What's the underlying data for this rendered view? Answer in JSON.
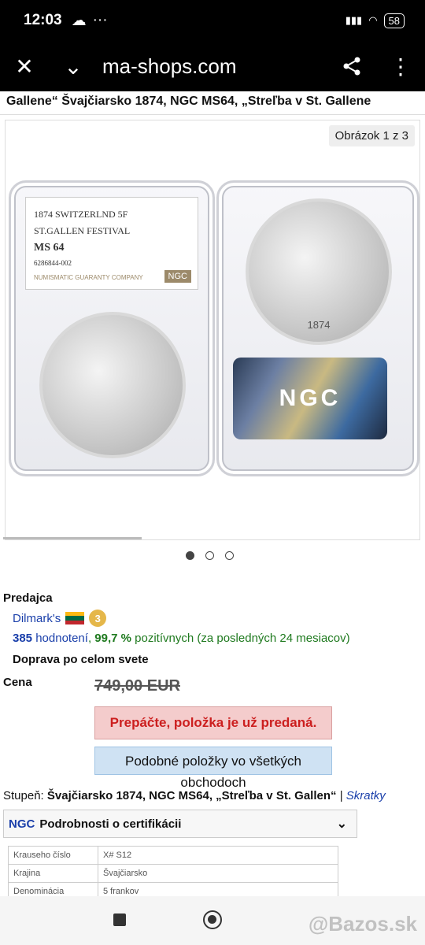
{
  "status_bar": {
    "time": "12:03",
    "battery": "58"
  },
  "browser": {
    "url": "ma-shops.com"
  },
  "breadcrumb": "Gallene“ Švajčiarsko 1874, NGC MS64, „Streľba v St. Gallene",
  "gallery": {
    "counter": "Obrázok 1 z 3",
    "label_line1": "1874 SWITZERLND 5F",
    "label_line2": "ST.GALLEN FESTIVAL",
    "label_grade": "MS 64",
    "label_cert": "6286844-002",
    "label_company": "NUMISMATIC GUARANTY COMPANY",
    "label_logo": "NGC",
    "hologram_text": "NGC",
    "coin_date": "1874",
    "dots": 3,
    "active_dot": 0
  },
  "seller": {
    "section_title": "Predajca",
    "name": "Dilmark's",
    "level": "3",
    "rating_count": "385",
    "rating_label": "hodnotení",
    "rating_pct": "99,7 %",
    "rating_text": "pozitívnych (za posledných 24 mesiacov)",
    "shipping": "Doprava po celom svete"
  },
  "price": {
    "label": "Cena",
    "value": "749,00 EUR",
    "sold_message": "Prepáčte, položka je už predaná.",
    "similar_button_line1": "Podobné položky vo všetkých",
    "similar_button_line2": "obchodoch"
  },
  "grade_line": {
    "prefix": "Stupeň:",
    "value": "Švajčiarsko 1874, NGC MS64, „Streľba v St. Gallen“",
    "separator": "|",
    "link": "Skratky"
  },
  "certification": {
    "logo": "NGC",
    "title": "Podrobnosti o certifikácii"
  },
  "details": [
    {
      "label": "Krauseho číslo",
      "value": "X# S12"
    },
    {
      "label": "Krajina",
      "value": "Švajčiarsko"
    },
    {
      "label": "Denominácia",
      "value": "5 frankov"
    }
  ],
  "watermark": "@Bazos.sk",
  "colors": {
    "sold_bg": "#f4cccc",
    "sold_text": "#cc1f1f",
    "similar_bg": "#cfe2f3",
    "link": "#1a3faa",
    "positive": "#1f7a1f"
  }
}
